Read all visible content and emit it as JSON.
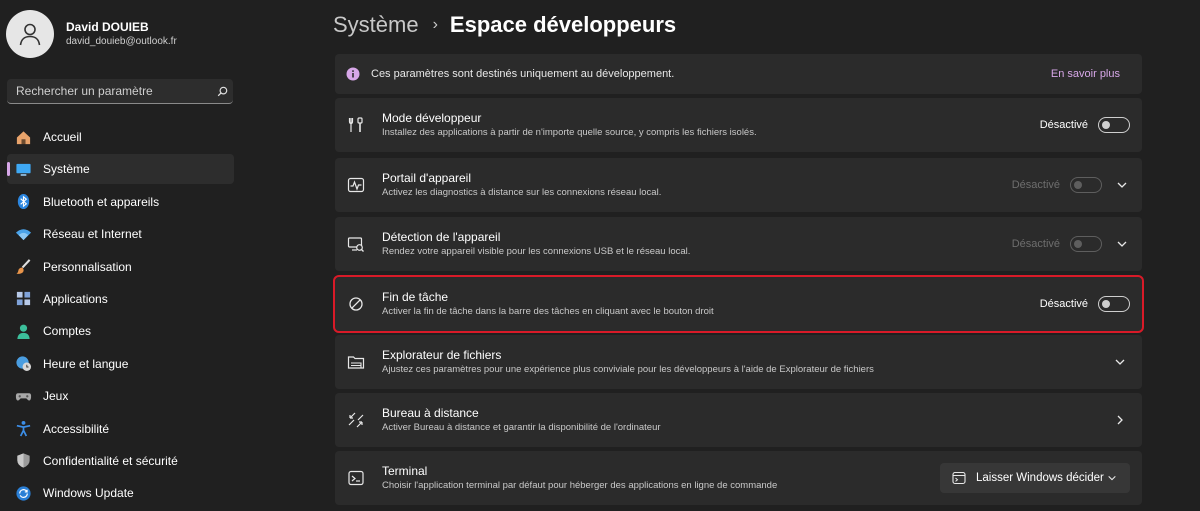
{
  "user": {
    "name": "David DOUIEB",
    "email": "david_douieb@outlook.fr"
  },
  "search": {
    "placeholder": "Rechercher un paramètre",
    "icon": "search-icon"
  },
  "sidebar": {
    "items": [
      {
        "label": "Accueil",
        "icon": "home-icon"
      },
      {
        "label": "Système",
        "icon": "display-icon",
        "active": true
      },
      {
        "label": "Bluetooth et appareils",
        "icon": "bluetooth-icon"
      },
      {
        "label": "Réseau et Internet",
        "icon": "wifi-icon"
      },
      {
        "label": "Personnalisation",
        "icon": "brush-icon"
      },
      {
        "label": "Applications",
        "icon": "apps-icon"
      },
      {
        "label": "Comptes",
        "icon": "person-icon"
      },
      {
        "label": "Heure et langue",
        "icon": "globe-clock-icon"
      },
      {
        "label": "Jeux",
        "icon": "gamepad-icon"
      },
      {
        "label": "Accessibilité",
        "icon": "accessibility-icon"
      },
      {
        "label": "Confidentialité et sécurité",
        "icon": "shield-icon"
      },
      {
        "label": "Windows Update",
        "icon": "update-icon"
      }
    ]
  },
  "breadcrumb": {
    "parent": "Système",
    "separator": "›",
    "current": "Espace développeurs"
  },
  "info": {
    "text": "Ces paramètres sont destinés uniquement au développement.",
    "link": "En savoir plus"
  },
  "cards": [
    {
      "title": "Mode développeur",
      "desc": "Installez des applications à partir de n'importe quelle source, y compris les fichiers isolés.",
      "state": "Désactivé",
      "icon": "tools-icon"
    },
    {
      "title": "Portail d'appareil",
      "desc": "Activez les diagnostics à distance sur les connexions réseau local.",
      "state": "Désactivé",
      "icon": "pulse-icon"
    },
    {
      "title": "Détection de l'appareil",
      "desc": "Rendez votre appareil visible pour les connexions USB et le réseau local.",
      "state": "Désactivé",
      "icon": "device-discovery-icon"
    },
    {
      "title": "Fin de tâche",
      "desc": "Activer la fin de tâche dans la barre des tâches en cliquant avec le bouton droit",
      "state": "Désactivé",
      "icon": "block-icon"
    },
    {
      "title": "Explorateur de fichiers",
      "desc": "Ajustez ces paramètres pour une expérience plus conviviale pour les développeurs à l'aide de Explorateur de fichiers",
      "icon": "folder-icon"
    },
    {
      "title": "Bureau à distance",
      "desc": "Activer Bureau à distance et garantir la disponibilité de l'ordinateur",
      "icon": "remote-desktop-icon"
    },
    {
      "title": "Terminal",
      "desc": "Choisir l'application terminal par défaut pour héberger des applications en ligne de commande",
      "icon": "terminal-icon",
      "dropdown": "Laisser Windows décider"
    }
  ],
  "colors": {
    "accent": "#d7a7e8",
    "highlight": "#d91a28",
    "background": "#202020",
    "card": "#2b2b2b"
  }
}
